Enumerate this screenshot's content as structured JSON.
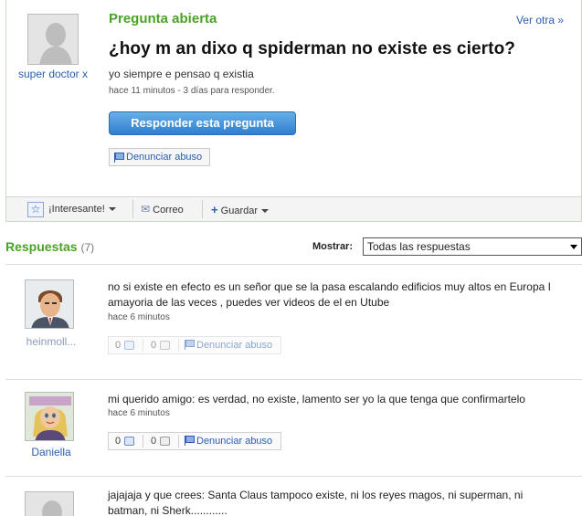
{
  "question": {
    "author": "super doctor x",
    "status": "Pregunta abierta",
    "view_more": "Ver otra »",
    "title": "¿hoy m an dixo q spiderman no existe es cierto?",
    "detail": "yo siempre e pensao q existia",
    "meta": "hace 11 minutos - 3 días para responder.",
    "answer_button": "Responder esta pregunta",
    "report_button": "Denunciar abuso",
    "toolbar": {
      "interesting": "¡Interesante!",
      "email": "Correo",
      "save": "Guardar"
    }
  },
  "responses": {
    "title": "Respuestas",
    "count": "(7)",
    "sort_label": "Mostrar:",
    "sort_value": "Todas las respuestas"
  },
  "answers": [
    {
      "author": "heinmoll...",
      "text": "no si existe en efecto es un señor que se la pasa escalando edificios muy altos en Europa I amayoria de las veces , puedes ver videos de el en Utube",
      "meta": "hace 6 minutos",
      "thumbs_up": "0",
      "thumbs_down": "0",
      "report": "Denunciar abuso"
    },
    {
      "author": "Daniella",
      "text": "mi querido amigo: es verdad, no existe, lamento ser yo la que tenga que confirmartelo",
      "meta": "hace 6 minutos",
      "thumbs_up": "0",
      "thumbs_down": "0",
      "report": "Denunciar abuso"
    },
    {
      "author": "",
      "text": "jajajaja y que crees: Santa Claus tampoco existe, ni los reyes magos, ni superman, ni batman, ni Sherk............"
    }
  ],
  "colors": {
    "green": "#4aa325",
    "link_blue": "#2a5db0",
    "button_blue": "#2f7fcf"
  }
}
